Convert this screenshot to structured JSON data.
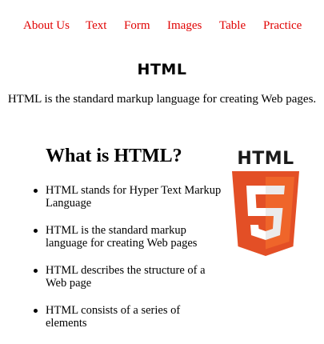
{
  "nav": {
    "items": [
      {
        "label": "About Us"
      },
      {
        "label": "Text"
      },
      {
        "label": "Form"
      },
      {
        "label": "Images"
      },
      {
        "label": "Table"
      },
      {
        "label": "Practice"
      }
    ],
    "link_color": "#e00000"
  },
  "main": {
    "title": "HTML",
    "intro": "HTML is the standard markup language for creating Web pages.",
    "section_heading": "What is HTML?",
    "facts": [
      "HTML stands for Hyper Text Markup Language",
      "HTML is the standard markup language for creating Web pages",
      "HTML describes the structure of a Web page",
      "HTML consists of a series of elements"
    ]
  },
  "logo": {
    "wordmark": "HTML",
    "badge_number": "5",
    "icon": "html5-shield-icon",
    "colors": {
      "outer": "#e34f26",
      "inner": "#ef652a",
      "glyph": "#ffffff",
      "glyph_shade": "#ebebeb"
    }
  }
}
